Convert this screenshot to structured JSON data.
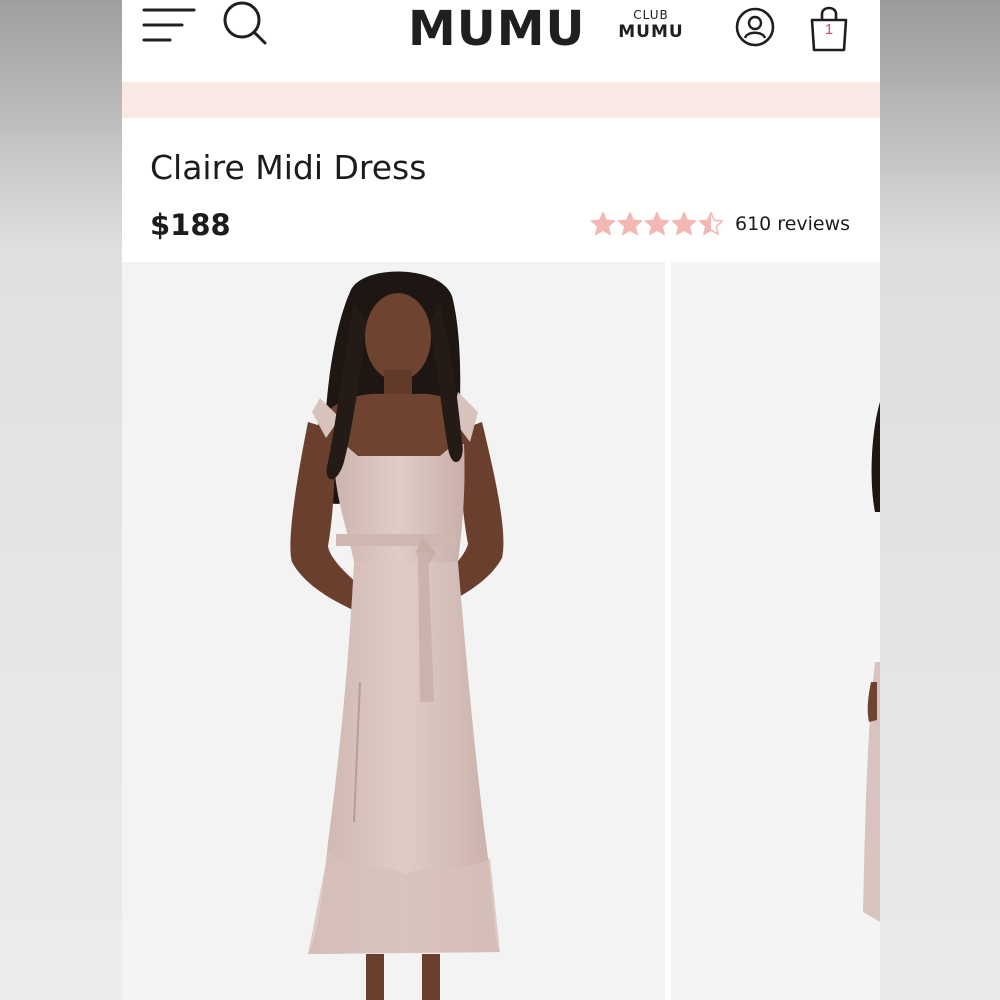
{
  "header": {
    "brand": "MUMU",
    "club_line1": "CLUB",
    "club_line2": "MUMU",
    "cart_count": "1"
  },
  "product": {
    "title": "Claire Midi Dress",
    "price": "$188",
    "rating": 4.5,
    "reviews_label": "610 reviews"
  },
  "icons": {
    "menu": "menu-icon",
    "search": "search-icon",
    "account": "account-icon",
    "bag": "shopping-bag-icon",
    "star": "star-icon"
  },
  "colors": {
    "promo_band": "#fbe9e5",
    "star": "#f3b8b4",
    "cart_count": "#e0457b",
    "dress": "#d9c3be",
    "skin": "#6e4330",
    "hair": "#1e1613"
  }
}
